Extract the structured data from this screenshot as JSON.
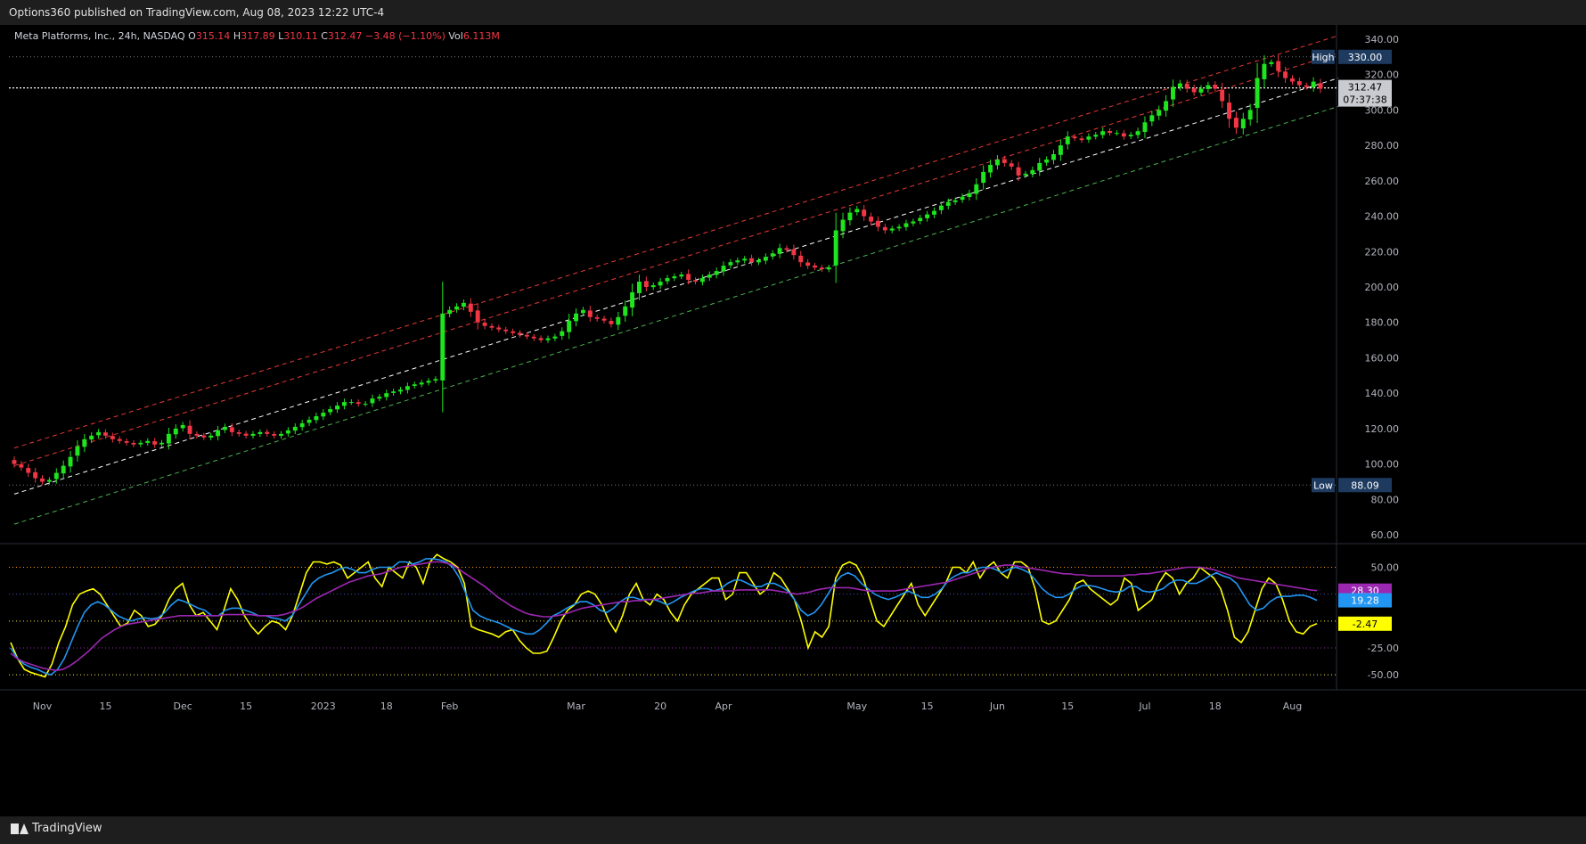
{
  "header": {
    "published": "Options360 published on TradingView.com, Aug 08, 2023 12:22 UTC-4"
  },
  "footer": {
    "brand": "TradingView"
  },
  "legend": {
    "title": "Meta Platforms, Inc., 24h, NASDAQ",
    "o_label": "O",
    "o": "315.14",
    "h_label": "H",
    "h": "317.89",
    "l_label": "L",
    "l": "310.11",
    "c_label": "C",
    "c": "312.47",
    "change": "−3.48 (−1.10%)",
    "vol_label": "Vol",
    "vol": "6.113M"
  },
  "colors": {
    "up": "#1ee51e",
    "down": "#f23645",
    "red_channel": "#e53935",
    "green_channel": "#4caf50",
    "white_line": "#ffffff",
    "yellow": "#ffff00",
    "blue": "#2196f3",
    "purple": "#9c27b0"
  },
  "chart_data": [
    {
      "type": "candlestick",
      "title": "Meta Platforms, Inc., 24h, NASDAQ",
      "ylim": [
        55,
        345
      ],
      "y_ticks": [
        "340.00",
        "320.00",
        "300.00",
        "280.00",
        "260.00",
        "240.00",
        "220.00",
        "200.00",
        "180.00",
        "160.00",
        "140.00",
        "120.00",
        "100.00",
        "80.00",
        "60.00"
      ],
      "x_ticks": [
        {
          "label": "Nov",
          "i": 4
        },
        {
          "label": "15",
          "i": 13
        },
        {
          "label": "Dec",
          "i": 24
        },
        {
          "label": "15",
          "i": 33
        },
        {
          "label": "2023",
          "i": 44
        },
        {
          "label": "18",
          "i": 53
        },
        {
          "label": "Feb",
          "i": 62
        },
        {
          "label": "Mar",
          "i": 80
        },
        {
          "label": "20",
          "i": 92
        },
        {
          "label": "Apr",
          "i": 101
        },
        {
          "label": "May",
          "i": 120
        },
        {
          "label": "15",
          "i": 130
        },
        {
          "label": "Jun",
          "i": 140
        },
        {
          "label": "15",
          "i": 150
        },
        {
          "label": "Jul",
          "i": 161
        },
        {
          "label": "18",
          "i": 171
        },
        {
          "label": "Aug",
          "i": 182
        }
      ],
      "high_marker": {
        "label": "High",
        "value": "330.00"
      },
      "low_marker": {
        "label": "Low",
        "value": "88.09"
      },
      "last_price": {
        "value": "312.47",
        "countdown": "07:37:38"
      },
      "channel_lines": [
        {
          "name": "red-upper",
          "color": "#e53935",
          "start": [
            0,
            109
          ],
          "end": [
            186,
            342
          ]
        },
        {
          "name": "red-middle",
          "color": "#e53935",
          "start": [
            0,
            99
          ],
          "end": [
            186,
            332
          ]
        },
        {
          "name": "white-midline",
          "color": "#ffffff",
          "start": [
            0,
            83
          ],
          "end": [
            186,
            318
          ]
        },
        {
          "name": "green-lower",
          "color": "#4caf50",
          "start": [
            0,
            66
          ],
          "end": [
            186,
            302
          ]
        }
      ],
      "closes": [
        100,
        98,
        95,
        92,
        90,
        91,
        95,
        99,
        104,
        110,
        114,
        116,
        118,
        116,
        114,
        113,
        112,
        111,
        112,
        113,
        111,
        112,
        117,
        120,
        122,
        117,
        116,
        115,
        116,
        119,
        121,
        118,
        117,
        116,
        117,
        118,
        117,
        116,
        117,
        119,
        121,
        123,
        125,
        127,
        129,
        131,
        133,
        135,
        135,
        134,
        134,
        137,
        138,
        140,
        141,
        142,
        144,
        145,
        146,
        147,
        148,
        185,
        187,
        189,
        191,
        186,
        180,
        178,
        177,
        176,
        175,
        174,
        173,
        172,
        171,
        170,
        171,
        172,
        175,
        181,
        185,
        187,
        183,
        182,
        181,
        179,
        183,
        189,
        197,
        203,
        200,
        201,
        203,
        205,
        206,
        207,
        204,
        203,
        205,
        207,
        209,
        212,
        214,
        215,
        216,
        214,
        215,
        217,
        219,
        222,
        221,
        218,
        214,
        212,
        211,
        210,
        211,
        232,
        238,
        242,
        244,
        240,
        237,
        234,
        232,
        233,
        234,
        236,
        237,
        239,
        241,
        243,
        246,
        248,
        249,
        251,
        253,
        258,
        265,
        269,
        272,
        270,
        268,
        263,
        264,
        266,
        270,
        272,
        275,
        280,
        285,
        284,
        283,
        285,
        286,
        288,
        287,
        287,
        285,
        286,
        288,
        293,
        297,
        300,
        305,
        313,
        315,
        312,
        310,
        312,
        314,
        312,
        305,
        295,
        290,
        295,
        300,
        318,
        326,
        327,
        322,
        318,
        316,
        314,
        313,
        316,
        312
      ],
      "opens_note": "",
      "series": []
    },
    {
      "type": "line",
      "title": "",
      "ylim": [
        -64,
        72
      ],
      "y_ticks": [
        "50.00",
        "-25.00",
        "-50.00"
      ],
      "hlines": [
        {
          "value": 50,
          "color": "#ff9800"
        },
        {
          "value": 25,
          "color": "#3f51b5"
        },
        {
          "value": 0,
          "color": "#ffeb3b"
        },
        {
          "value": -25,
          "color": "#9c27b0"
        },
        {
          "value": -50,
          "color": "#ffeb3b"
        }
      ],
      "series": [
        {
          "name": "",
          "color": "#ffff00",
          "last": "-2.47",
          "values": [
            -20,
            -35,
            -45,
            -48,
            -50,
            -52,
            -40,
            -20,
            -5,
            15,
            25,
            28,
            30,
            25,
            15,
            5,
            -5,
            -2,
            10,
            5,
            -5,
            -3,
            5,
            20,
            30,
            35,
            15,
            5,
            8,
            0,
            -8,
            10,
            30,
            20,
            5,
            -5,
            -12,
            -5,
            0,
            -2,
            -8,
            5,
            25,
            45,
            55,
            55,
            53,
            55,
            52,
            40,
            45,
            50,
            55,
            40,
            32,
            50,
            45,
            40,
            55,
            50,
            35,
            55,
            62,
            58,
            55,
            50,
            35,
            -5,
            -8,
            -10,
            -12,
            -15,
            -10,
            -8,
            -18,
            -25,
            -30,
            -30,
            -28,
            -15,
            0,
            10,
            15,
            25,
            28,
            25,
            15,
            0,
            -10,
            5,
            25,
            35,
            20,
            15,
            25,
            20,
            8,
            0,
            15,
            25,
            30,
            35,
            40,
            40,
            20,
            25,
            45,
            45,
            35,
            25,
            30,
            45,
            40,
            30,
            20,
            0,
            -25,
            -10,
            -15,
            -5,
            40,
            52,
            55,
            52,
            40,
            20,
            0,
            -5,
            5,
            15,
            25,
            35,
            15,
            5,
            15,
            25,
            35,
            50,
            50,
            45,
            55,
            40,
            50,
            55,
            45,
            40,
            55,
            55,
            50,
            30,
            0,
            -3,
            0,
            10,
            20,
            35,
            38,
            30,
            25,
            20,
            15,
            20,
            40,
            35,
            10,
            15,
            20,
            35,
            45,
            40,
            25,
            35,
            40,
            50,
            45,
            40,
            30,
            10,
            -15,
            -20,
            -10,
            10,
            30,
            40,
            35,
            20,
            0,
            -10,
            -12,
            -5,
            -2.47
          ]
        },
        {
          "name": "",
          "color": "#2196f3",
          "last": "19.28",
          "values": [
            -25,
            -35,
            -40,
            -43,
            -45,
            -48,
            -50,
            -45,
            -35,
            -20,
            -5,
            8,
            15,
            18,
            15,
            10,
            5,
            2,
            0,
            2,
            3,
            2,
            3,
            8,
            15,
            20,
            18,
            15,
            12,
            10,
            5,
            5,
            10,
            12,
            12,
            10,
            8,
            5,
            5,
            3,
            2,
            0,
            5,
            15,
            25,
            35,
            40,
            43,
            45,
            48,
            50,
            48,
            45,
            45,
            48,
            50,
            50,
            50,
            55,
            55,
            53,
            55,
            58,
            58,
            57,
            55,
            50,
            40,
            25,
            10,
            5,
            2,
            0,
            -2,
            -5,
            -8,
            -10,
            -12,
            -12,
            -8,
            -2,
            5,
            8,
            12,
            15,
            18,
            18,
            15,
            10,
            8,
            12,
            18,
            22,
            22,
            20,
            20,
            20,
            18,
            15,
            18,
            22,
            25,
            28,
            30,
            30,
            28,
            30,
            35,
            38,
            38,
            35,
            32,
            32,
            35,
            35,
            32,
            28,
            20,
            10,
            5,
            8,
            15,
            25,
            35,
            42,
            45,
            42,
            35,
            30,
            25,
            22,
            20,
            22,
            25,
            28,
            25,
            22,
            22,
            25,
            30,
            38,
            42,
            45,
            45,
            48,
            50,
            50,
            48,
            45,
            48,
            50,
            48,
            45,
            38,
            30,
            25,
            22,
            22,
            25,
            30,
            33,
            33,
            32,
            30,
            28,
            27,
            28,
            32,
            32,
            28,
            27,
            28,
            30,
            35,
            38,
            38,
            35,
            35,
            38,
            42,
            45,
            42,
            40,
            35,
            25,
            15,
            10,
            12,
            18,
            22,
            23,
            23,
            24,
            24,
            22,
            19.28
          ]
        },
        {
          "name": "",
          "color": "#9c27b0",
          "last": "28.30",
          "values": [
            -30,
            -35,
            -38,
            -40,
            -42,
            -44,
            -45,
            -46,
            -45,
            -42,
            -38,
            -33,
            -28,
            -22,
            -16,
            -12,
            -8,
            -5,
            -3,
            -2,
            -1,
            0,
            1,
            2,
            3,
            4,
            5,
            5,
            5,
            5,
            5,
            5,
            5,
            6,
            6,
            6,
            6,
            6,
            5,
            5,
            5,
            5,
            6,
            8,
            10,
            13,
            17,
            21,
            24,
            27,
            30,
            33,
            36,
            38,
            40,
            42,
            43,
            44,
            46,
            48,
            50,
            51,
            52,
            53,
            54,
            55,
            55,
            54,
            52,
            48,
            44,
            40,
            36,
            32,
            27,
            22,
            18,
            14,
            11,
            8,
            6,
            5,
            4,
            4,
            5,
            6,
            8,
            10,
            12,
            13,
            14,
            15,
            16,
            17,
            18,
            18,
            19,
            19,
            20,
            20,
            21,
            22,
            23,
            24,
            25,
            26,
            26,
            27,
            28,
            28,
            28,
            28,
            29,
            29,
            29,
            29,
            29,
            29,
            28,
            27,
            26,
            25,
            26,
            27,
            29,
            30,
            31,
            31,
            31,
            31,
            30,
            29,
            28,
            28,
            28,
            28,
            28,
            29,
            30,
            31,
            32,
            33,
            34,
            35,
            36,
            38,
            40,
            42,
            44,
            46,
            48,
            50,
            51,
            52,
            52,
            51,
            50,
            49,
            48,
            47,
            46,
            45,
            44,
            44,
            43,
            43,
            42,
            42,
            42,
            42,
            42,
            42,
            43,
            43,
            44,
            44,
            45,
            46,
            47,
            48,
            49,
            50,
            50,
            50,
            49,
            48,
            46,
            44,
            42,
            40,
            39,
            38,
            37,
            36,
            35,
            34,
            33,
            32,
            31,
            30,
            29,
            28.3
          ]
        }
      ],
      "last_labels": [
        {
          "value": "28.30",
          "color": "#9c27b0",
          "text_color": "#ffffff"
        },
        {
          "value": "19.28",
          "color": "#2196f3",
          "text_color": "#ffffff"
        },
        {
          "value": "-2.47",
          "color": "#ffff00",
          "text_color": "#000000"
        }
      ]
    }
  ]
}
